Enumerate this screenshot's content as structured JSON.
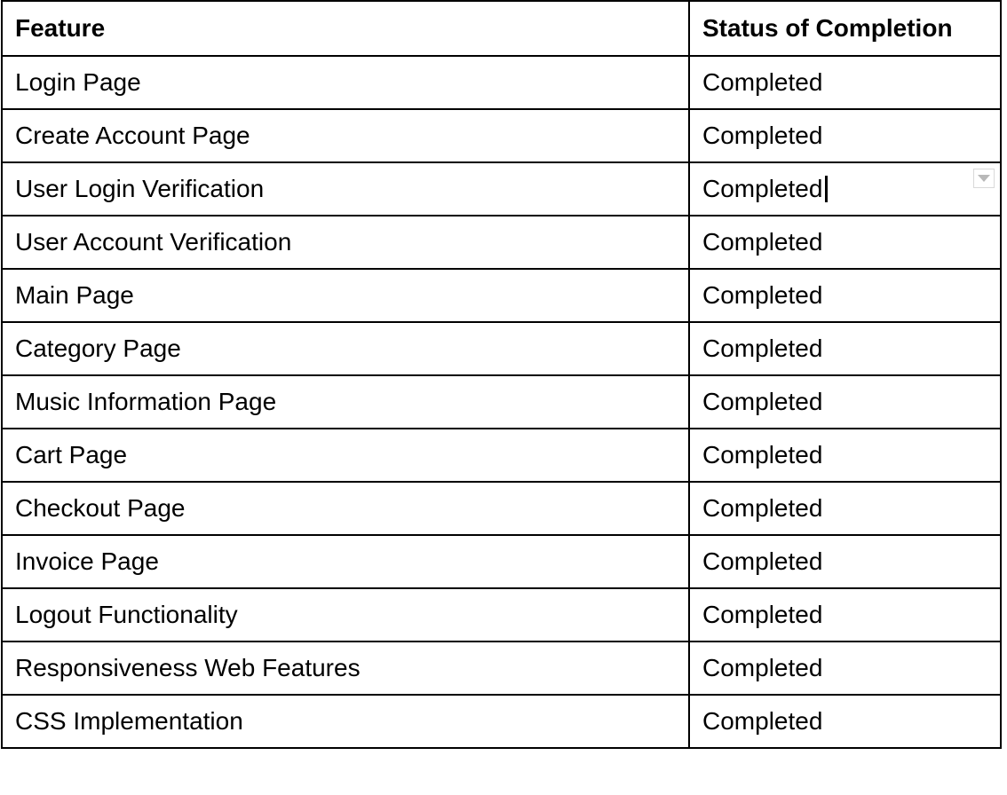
{
  "table": {
    "headers": [
      "Feature",
      "Status of Completion"
    ],
    "rows": [
      {
        "feature": "Login Page",
        "status": "Completed"
      },
      {
        "feature": "Create Account Page",
        "status": "Completed"
      },
      {
        "feature": "User Login Verification",
        "status": "Completed"
      },
      {
        "feature": "User Account Verification",
        "status": "Completed"
      },
      {
        "feature": "Main Page",
        "status": "Completed"
      },
      {
        "feature": "Category Page",
        "status": "Completed"
      },
      {
        "feature": "Music Information Page",
        "status": "Completed"
      },
      {
        "feature": "Cart Page",
        "status": "Completed"
      },
      {
        "feature": "Checkout Page",
        "status": "Completed"
      },
      {
        "feature": "Invoice Page",
        "status": "Completed"
      },
      {
        "feature": "Logout Functionality",
        "status": "Completed"
      },
      {
        "feature": "Responsiveness Web Features",
        "status": "Completed"
      },
      {
        "feature": "CSS Implementation",
        "status": "Completed"
      }
    ]
  },
  "editor": {
    "active_row": 2,
    "dropdown_icon": "chevron-down-icon"
  }
}
